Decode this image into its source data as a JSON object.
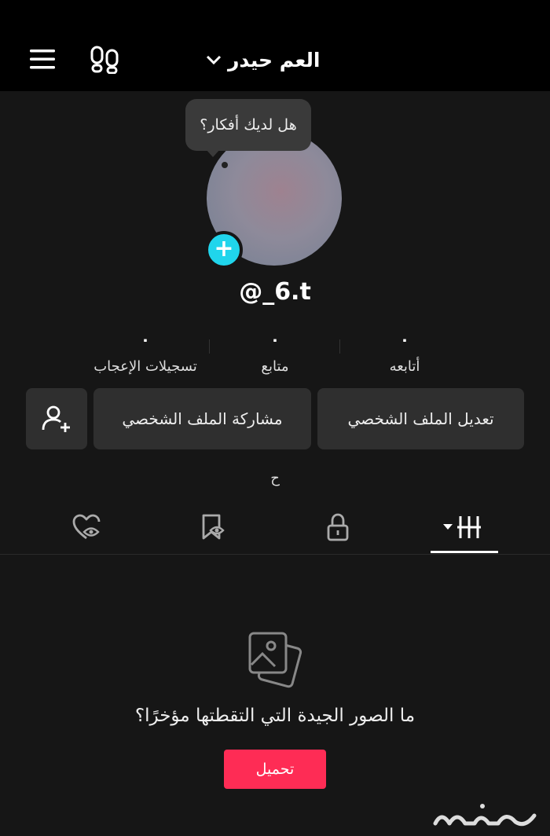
{
  "header": {
    "title": "العم حيدر"
  },
  "bubble": {
    "text": "هل لديك أفكار؟"
  },
  "profile": {
    "username": "@_6.t",
    "bio": "ح"
  },
  "stats": [
    {
      "value": "٠",
      "label": "أتابعه"
    },
    {
      "value": "٠",
      "label": "متابع"
    },
    {
      "value": "٠",
      "label": "تسجيلات الإعجاب"
    }
  ],
  "buttons": {
    "edit": "تعديل الملف الشخصي",
    "share": "مشاركة الملف الشخصي"
  },
  "tabs": [
    {
      "icon": "grid-icon",
      "active": true
    },
    {
      "icon": "lock-icon",
      "active": false
    },
    {
      "icon": "bookmark-hidden-icon",
      "active": false
    },
    {
      "icon": "heart-hidden-icon",
      "active": false
    }
  ],
  "empty_state": {
    "text": "ما الصور الجيدة التي التقطتها مؤخرًا؟",
    "button": "تحميل"
  },
  "colors": {
    "accent": "#fe2c55",
    "add_badge": "#20d5ec",
    "background": "#161616",
    "button_bg": "#2f2f2f"
  },
  "watermark": {
    "text": "حراج"
  }
}
